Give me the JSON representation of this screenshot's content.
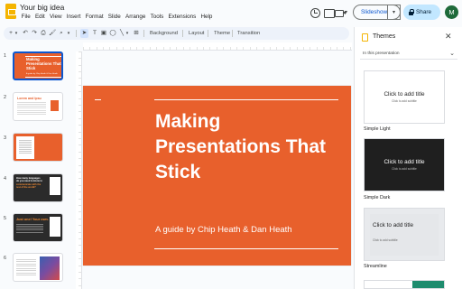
{
  "app": {
    "doc_title": "Your big idea",
    "avatar_initial": "M",
    "accent_color": "#0b57d0",
    "brand_color": "#f4b400"
  },
  "menu": [
    "File",
    "Edit",
    "View",
    "Insert",
    "Format",
    "Slide",
    "Arrange",
    "Tools",
    "Extensions",
    "Help"
  ],
  "header_actions": {
    "slideshow_label": "Slideshow",
    "share_label": "Share"
  },
  "toolbar": {
    "background_label": "Background",
    "layout_label": "Layout",
    "theme_label": "Theme",
    "transition_label": "Transition"
  },
  "filmstrip": {
    "slides": [
      {
        "number": "1",
        "title": "Making Presentations That Stick",
        "subtitle": "A guide by Chip Heath & Dan Heath"
      },
      {
        "number": "2",
        "title": "Lorem and Ipsu"
      },
      {
        "number": "3"
      },
      {
        "number": "4",
        "title": "How many languages do you need to know to communicate with the rest of the world?"
      },
      {
        "number": "5",
        "title": "Just one! Your own."
      },
      {
        "number": "6"
      }
    ],
    "slide4_highlight": "communicate with the rest of the world?"
  },
  "slide": {
    "title": "Making Presentations That Stick",
    "subtitle": "A guide by Chip Heath & Dan Heath",
    "background_color": "#e8602c"
  },
  "themes_panel": {
    "title": "Themes",
    "section_label": "In this presentation",
    "themes": [
      {
        "name": "Simple Light",
        "placeholder_title": "Click to add title",
        "placeholder_subtitle": "Click to add subtitle"
      },
      {
        "name": "Simple Dark",
        "placeholder_title": "Click to add title",
        "placeholder_subtitle": "Click to add subtitle"
      },
      {
        "name": "Streamline",
        "placeholder_title": "Click to add title",
        "placeholder_subtitle": "Click to add subtitle"
      }
    ]
  }
}
